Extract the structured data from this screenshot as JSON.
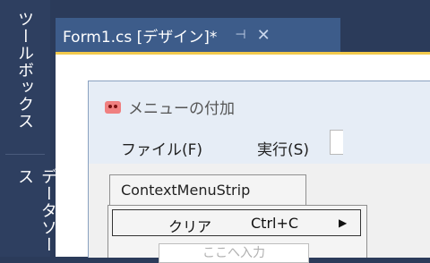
{
  "sidebar": {
    "tabs": [
      {
        "label": "ツールボックス"
      },
      {
        "label": "データソース"
      }
    ]
  },
  "document_tab": {
    "title": "Form1.cs [デザイン]*",
    "pin_icon": "pin-icon",
    "close_icon": "close-icon"
  },
  "form": {
    "title": "メニューの付加",
    "menubar": [
      {
        "label": "ファイル(F)"
      },
      {
        "label": "実行(S)"
      }
    ]
  },
  "context_menu_strip": {
    "label": "ContextMenuStrip",
    "items": [
      {
        "label": "クリア",
        "shortcut": "Ctrl+C",
        "submenu_glyph": "▶"
      }
    ],
    "new_item_placeholder": "ここへ入力"
  },
  "colors": {
    "ide_dark": "#2b3b5a",
    "tab_active": "#3d5c8a",
    "tab_underline": "#f2c94c",
    "form_bg": "#e6edf6"
  }
}
